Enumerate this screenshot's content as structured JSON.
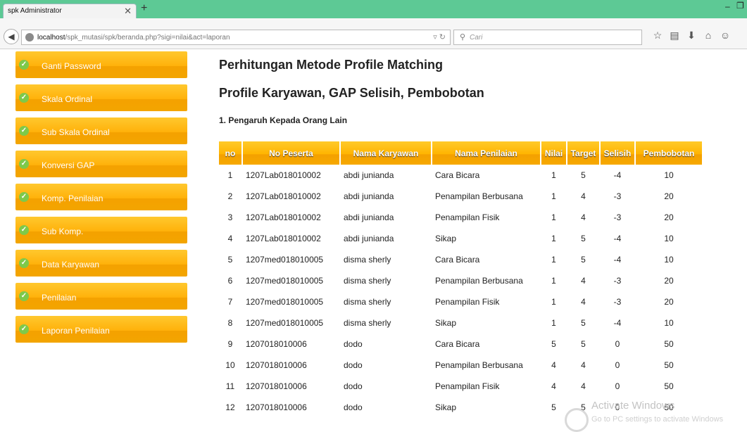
{
  "browser": {
    "tab_title": "spk Administrator",
    "url_host": "localhost",
    "url_path": "/spk_mutasi/spk/beranda.php?sigi=nilai&act=laporan",
    "search_placeholder": "Cari",
    "icons": [
      "back-icon",
      "globe-icon",
      "reload-icon",
      "search-icon",
      "bookmark-star-icon",
      "reading-list-icon",
      "download-icon",
      "home-icon",
      "chat-icon"
    ]
  },
  "sidebar": {
    "items": [
      {
        "label": "Ganti Password"
      },
      {
        "label": "Skala Ordinal"
      },
      {
        "label": "Sub Skala Ordinal"
      },
      {
        "label": "Konversi GAP"
      },
      {
        "label": "Komp. Penilaian"
      },
      {
        "label": "Sub Komp."
      },
      {
        "label": "Data Karyawan"
      },
      {
        "label": "Penilaian"
      },
      {
        "label": "Laporan Penilaian"
      }
    ]
  },
  "main": {
    "title": "Perhitungan Metode Profile Matching",
    "subtitle": "Profile Karyawan, GAP Selisih, Pembobotan",
    "section": "1. Pengaruh Kepada Orang Lain",
    "table": {
      "headers": [
        "no",
        "No Peserta",
        "Nama Karyawan",
        "Nama Penilaian",
        "Nilai",
        "Target",
        "Selisih",
        "Pembobotan"
      ],
      "rows": [
        [
          "1",
          "1207Lab018010002",
          "abdi junianda",
          "Cara Bicara",
          "1",
          "5",
          "-4",
          "10"
        ],
        [
          "2",
          "1207Lab018010002",
          "abdi junianda",
          "Penampilan Berbusana",
          "1",
          "4",
          "-3",
          "20"
        ],
        [
          "3",
          "1207Lab018010002",
          "abdi junianda",
          "Penampilan Fisik",
          "1",
          "4",
          "-3",
          "20"
        ],
        [
          "4",
          "1207Lab018010002",
          "abdi junianda",
          "Sikap",
          "1",
          "5",
          "-4",
          "10"
        ],
        [
          "5",
          "1207med018010005",
          "disma sherly",
          "Cara Bicara",
          "1",
          "5",
          "-4",
          "10"
        ],
        [
          "6",
          "1207med018010005",
          "disma sherly",
          "Penampilan Berbusana",
          "1",
          "4",
          "-3",
          "20"
        ],
        [
          "7",
          "1207med018010005",
          "disma sherly",
          "Penampilan Fisik",
          "1",
          "4",
          "-3",
          "20"
        ],
        [
          "8",
          "1207med018010005",
          "disma sherly",
          "Sikap",
          "1",
          "5",
          "-4",
          "10"
        ],
        [
          "9",
          "1207018010006",
          "dodo",
          "Cara Bicara",
          "5",
          "5",
          "0",
          "50"
        ],
        [
          "10",
          "1207018010006",
          "dodo",
          "Penampilan Berbusana",
          "4",
          "4",
          "0",
          "50"
        ],
        [
          "11",
          "1207018010006",
          "dodo",
          "Penampilan Fisik",
          "4",
          "4",
          "0",
          "50"
        ],
        [
          "12",
          "1207018010006",
          "dodo",
          "Sikap",
          "5",
          "5",
          "0",
          "50"
        ]
      ]
    }
  },
  "watermark": {
    "title": "Activate Windows",
    "subtitle": "Go to PC settings to activate Windows"
  },
  "colors": {
    "tabbar": "#5dc995",
    "menu_button": "#ffb10a",
    "table_header": "#ffb400",
    "check": "#7ec94a"
  }
}
